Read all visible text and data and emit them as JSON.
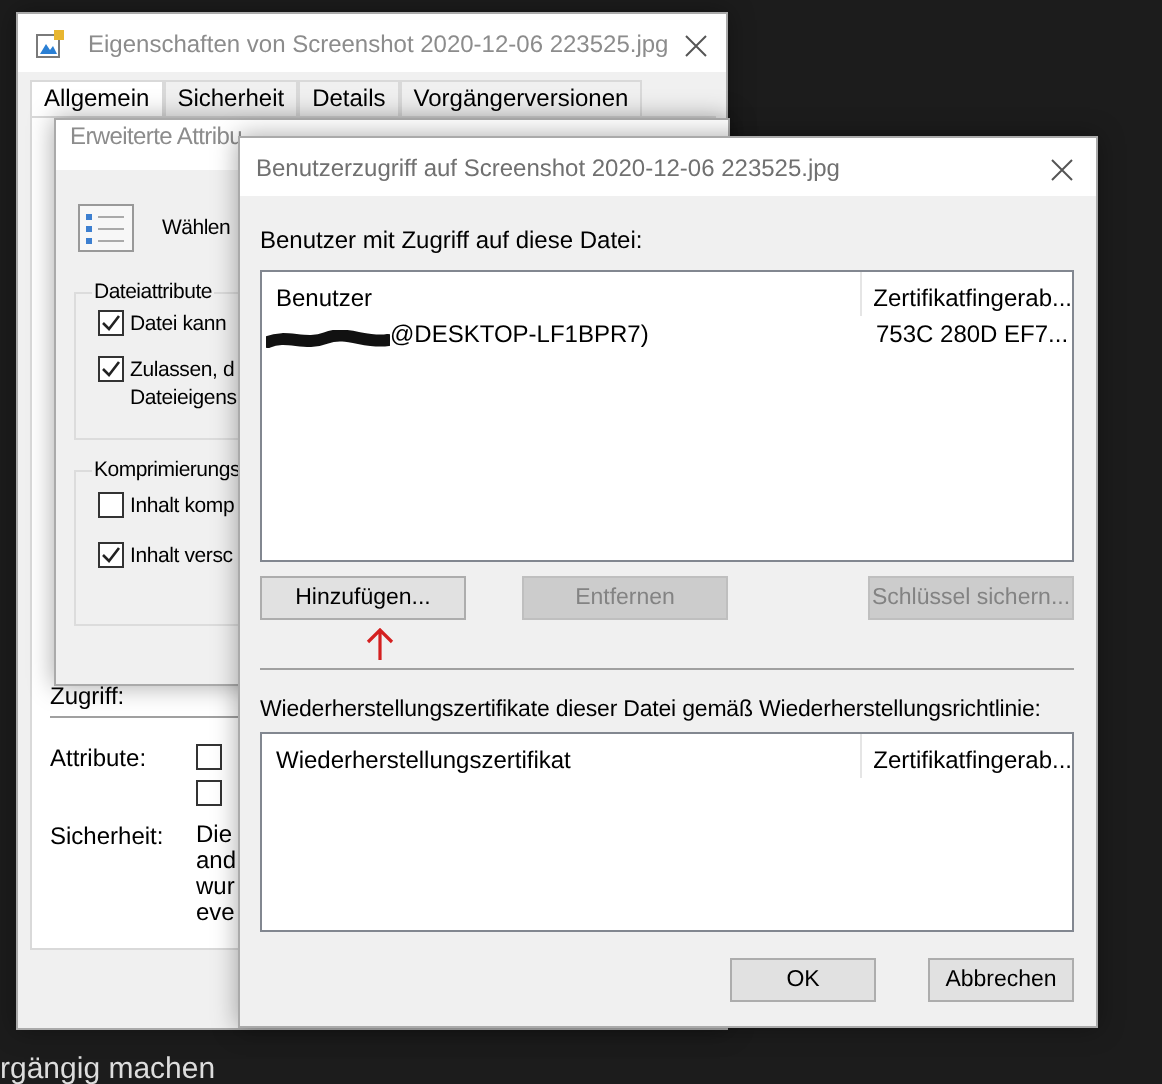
{
  "background": {
    "text": "rgängig machen"
  },
  "properties_window": {
    "title": "Eigenschaften von Screenshot 2020-12-06 223525.jpg",
    "tabs": [
      {
        "label": "Allgemein",
        "selected": true
      },
      {
        "label": "Sicherheit",
        "selected": false
      },
      {
        "label": "Details",
        "selected": false
      },
      {
        "label": "Vorgängerversionen",
        "selected": false
      }
    ],
    "access_label": "Zugriff:",
    "attributes": {
      "label": "Attribute:",
      "checkboxes": [
        {
          "checked": false
        },
        {
          "checked": false
        }
      ]
    },
    "security": {
      "label": "Sicherheit:",
      "lines": [
        "Die",
        "and",
        "wur",
        "eve"
      ]
    }
  },
  "advanced_window": {
    "title": "Erweiterte Attribu",
    "intro": "Wählen",
    "groups": [
      {
        "title": "Dateiattribute",
        "options": [
          {
            "lines": [
              "Datei kann"
            ],
            "checked": true
          },
          {
            "lines": [
              "Zulassen, d",
              "Dateieigens"
            ],
            "checked": true
          }
        ]
      },
      {
        "title": "Komprimierungs",
        "options": [
          {
            "lines": [
              "Inhalt komp"
            ],
            "checked": false
          },
          {
            "lines": [
              "Inhalt versc"
            ],
            "checked": true
          }
        ]
      }
    ]
  },
  "access_dialog": {
    "title": "Benutzerzugriff auf Screenshot 2020-12-06 223525.jpg",
    "users_label": "Benutzer mit Zugriff auf diese Datei:",
    "users_table": {
      "columns": [
        "Benutzer",
        "Zertifikatfingerab..."
      ],
      "rows": [
        {
          "user": "@DESKTOP-LF1BPR7)",
          "redacted": true,
          "fingerprint": "753C 280D EF7..."
        }
      ]
    },
    "buttons": [
      {
        "label": "Hinzufügen...",
        "disabled": false
      },
      {
        "label": "Entfernen",
        "disabled": true
      },
      {
        "label": "Schlüssel sichern...",
        "disabled": true
      }
    ],
    "recovery_label": "Wiederherstellungszertifikate dieser Datei gemäß Wiederherstellungsrichtlinie:",
    "recovery_table": {
      "columns": [
        "Wiederherstellungszertifikat",
        "Zertifikatfingerab..."
      ]
    },
    "footer_buttons": [
      {
        "label": "OK"
      },
      {
        "label": "Abbrechen"
      }
    ]
  }
}
